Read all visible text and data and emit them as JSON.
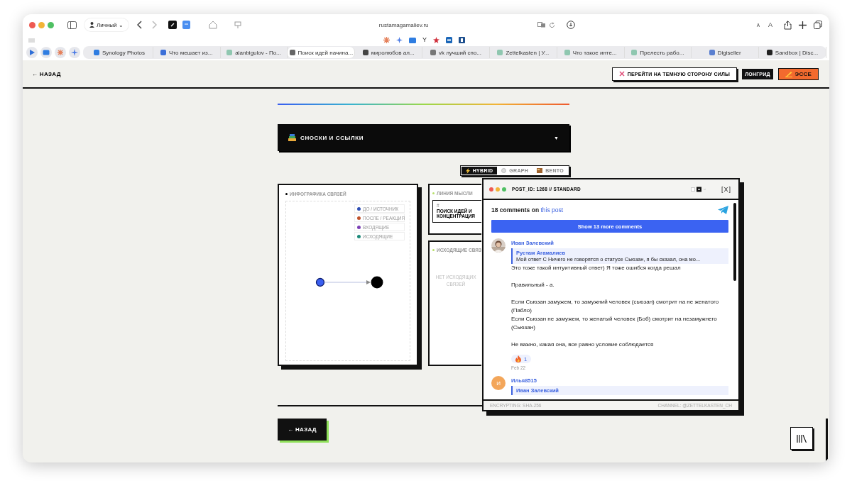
{
  "browser": {
    "profile": "Личный",
    "profile_caret": "⌄",
    "address": "rustamagamaliev.ru",
    "bookmark_letter": "Y",
    "text_size_buttons": [
      "A",
      "A"
    ],
    "tabs": [
      {
        "title": "Synology Photos",
        "selected": false
      },
      {
        "title": "Что мешает из...",
        "selected": false
      },
      {
        "title": "alanbigulov - По...",
        "selected": false
      },
      {
        "title": "Поиск идей начина...",
        "selected": true
      },
      {
        "title": "миролюбов ал...",
        "selected": false
      },
      {
        "title": "vk лучший спо...",
        "selected": false
      },
      {
        "title": "Zettelkasten | У...",
        "selected": false
      },
      {
        "title": "Что такое инте...",
        "selected": false
      },
      {
        "title": "Прелесть рабо...",
        "selected": false
      },
      {
        "title": "Digiseller",
        "selected": false
      },
      {
        "title": "Sandbox | Disc...",
        "selected": false
      }
    ]
  },
  "header": {
    "back": "← НАЗАД",
    "buttons": [
      {
        "label": "ПЕРЕЙТИ НА ТЕМНУЮ СТОРОНУ СИЛЫ",
        "kind": "theme"
      },
      {
        "label": "ЛОНГРИД",
        "kind": "dark"
      },
      {
        "label": "ЭССЕ",
        "kind": "accent"
      }
    ]
  },
  "footnotes_bar": {
    "title": "СНОСКИ И ССЫЛКИ",
    "caret": "▼"
  },
  "view_tabs": [
    {
      "label": "HYBRID",
      "selected": true
    },
    {
      "label": "GRAPH",
      "selected": false
    },
    {
      "label": "BENTO",
      "selected": false
    }
  ],
  "graph_card": {
    "title": "ИНФОГРАФИКА СВЯЗЕЙ",
    "legend": [
      {
        "label": "ДО / ИСТОЧНИК",
        "color": "#2f4fb5"
      },
      {
        "label": "ПОСЛЕ / РЕАКЦИЯ",
        "color": "#c0522c"
      },
      {
        "label": "ВХОДЯЩИЕ",
        "color": "#7b3fb5"
      },
      {
        "label": "ИСХОДЯЩИЕ",
        "color": "#1d8a7a"
      }
    ]
  },
  "thought_card": {
    "title": "ЛИНИЯ МЫСЛИ",
    "marker": "#",
    "topic": "ПОИСК ИДЕЙ И КОНЦЕНТРАЦИЯ"
  },
  "outgoing_card": {
    "title": "ИСХОДЯЩИЕ СВЯЗ",
    "empty": "НЕТ ИСХОДЯЩИХ СВЯЗЕЙ"
  },
  "popup": {
    "title": "POST_ID: 1268 // STANDARD",
    "close": "[X]",
    "comments_count": "18 comments on",
    "post_link": "this post",
    "show_more": "Show 13 more comments",
    "comments": [
      {
        "author": "Иван Залевский",
        "avatar": {
          "kind": "picture"
        },
        "reply": {
          "author": "Рустам Агамалиев",
          "text": "Мой ответ С Ничего не говорятся о статусе Сьюзан, я бы сказал, она мо..."
        },
        "paragraphs": [
          [
            "Это тоже такой интуитивный ответ) Я тоже ошибся когда решал"
          ],
          [
            "Правильный - а."
          ],
          [
            "Если Сьюзан замужем, то замужний человек (сьюзан) смотрит на не женатого (Пабло)",
            "Если Сьюзан не замужем, то женатый человек (Боб) смотрит на незамужнего (Сьюзан)"
          ],
          [
            "Не важно, какая она, все равно условие соблюдается"
          ]
        ],
        "reaction_count": "1",
        "date": "Feb 22"
      },
      {
        "author": "Илья8515",
        "avatar": {
          "kind": "initial",
          "letter": "И"
        },
        "reply": {
          "author": "Иван Залевский"
        }
      }
    ],
    "footer_left": "ENCRYPTING: SHA-256",
    "footer_right": "CHANNEL: @ZETTELKASTEN_CH"
  },
  "bottom_back": "← НАЗАД"
}
